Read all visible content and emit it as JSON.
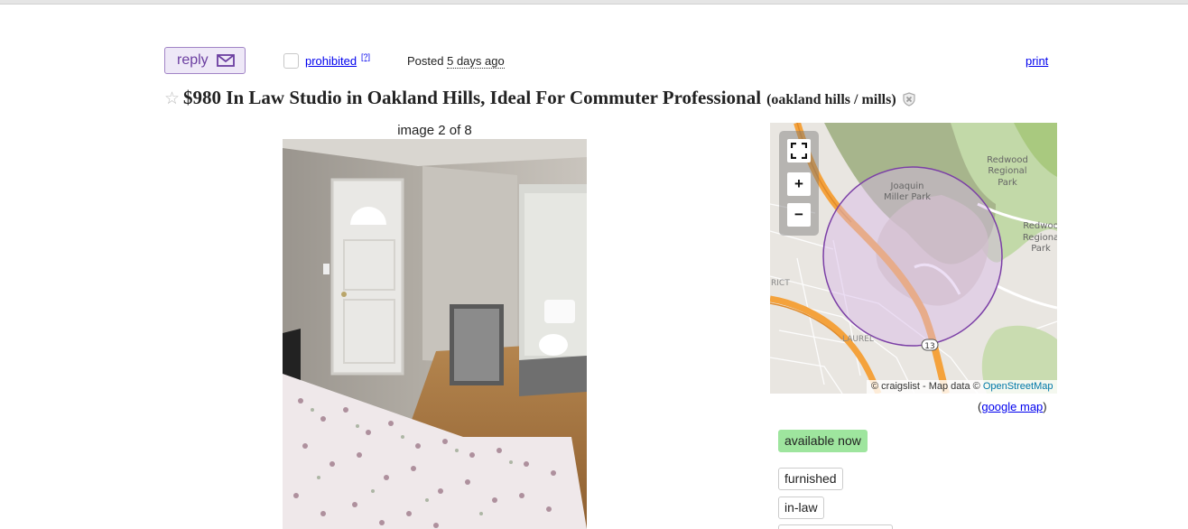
{
  "toolbar": {
    "reply_label": "reply",
    "prohibited_label": "prohibited",
    "help_label": "[?]",
    "posted_label": "Posted",
    "posted_time": "5 days ago",
    "print_label": "print"
  },
  "posting": {
    "title": "$980 In Law Studio in Oakland Hills, Ideal For Commuter Professional",
    "location": "(oakland hills / mills)"
  },
  "gallery": {
    "caption": "image 2 of 8"
  },
  "map": {
    "labels": {
      "joaquin": "Joaquin",
      "miller_park": "Miller Park",
      "redwood1_a": "Redwood",
      "redwood1_b": "Regional",
      "redwood1_c": "Park",
      "redwood2_a": "Redwoo",
      "redwood2_b": "Regiona",
      "redwood2_c": "Park",
      "laurel": "LAUREL",
      "district": "RICT",
      "hwy": "13"
    },
    "attribution_prefix": "© craigslist - Map data ©",
    "attribution_osm": "OpenStreetMap",
    "google_open": "(",
    "google_link": "google map",
    "google_close": ")"
  },
  "attributes": {
    "availability": "available now",
    "furnished": "furnished",
    "housing_type": "in-law"
  },
  "colors": {
    "accent_purple": "#6b3ea0",
    "link_blue": "#0000ee",
    "available_green": "#9ee59e",
    "highway_orange": "#f4a23c"
  }
}
